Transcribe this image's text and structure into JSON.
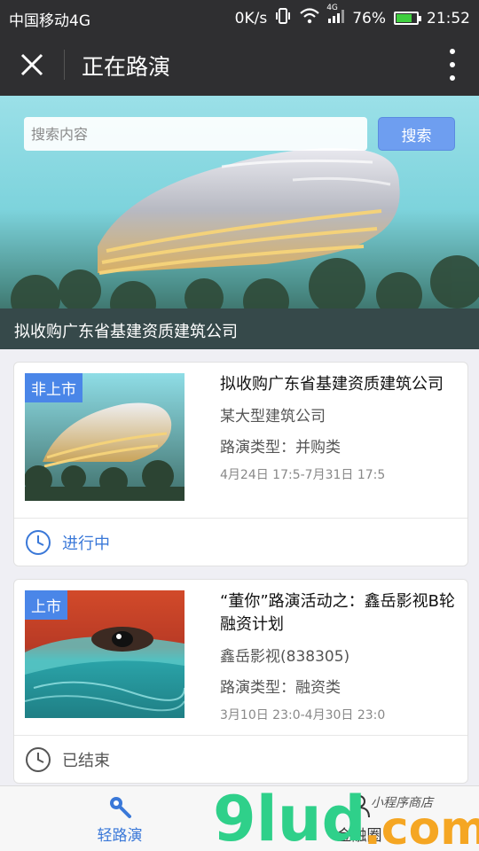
{
  "status_bar": {
    "carrier": "中国移动4G",
    "speed": "0K/s",
    "network": "4G",
    "battery_percent": "76%",
    "battery_level": 0.76,
    "time": "21:52"
  },
  "navbar": {
    "title": "正在路演"
  },
  "banner": {
    "search_placeholder": "搜索内容",
    "search_button": "搜索",
    "caption": "拟收购广东省基建资质建筑公司"
  },
  "cards": [
    {
      "tag": "非上市",
      "name": "拟收购广东省基建资质建筑公司",
      "company": "某大型建筑公司",
      "type": "路演类型：并购类",
      "time": "4月24日 17:5-7月31日 17:5",
      "status": "进行中",
      "status_color": "#3a78d8"
    },
    {
      "tag": "上市",
      "name": "“董你”路演活动之：鑫岳影视B轮融资计划",
      "company": "鑫岳影视(838305)",
      "type": "路演类型：融资类",
      "time": "3月10日 23:0-4月30日 23:0",
      "status": "已结束",
      "status_color": "#555555"
    }
  ],
  "tabbar": {
    "tabs": [
      {
        "label": "轻路演",
        "icon": "search-key-icon",
        "color": "#3a78d8"
      },
      {
        "label": "金融圈",
        "icon": "people-icon",
        "color": "#333333"
      }
    ]
  },
  "watermark": {
    "brand": "9lud",
    "suffix": ".com",
    "sub": "小程序商店"
  },
  "colors": {
    "accent": "#4a86e8",
    "navbar": "#2f2f31"
  }
}
